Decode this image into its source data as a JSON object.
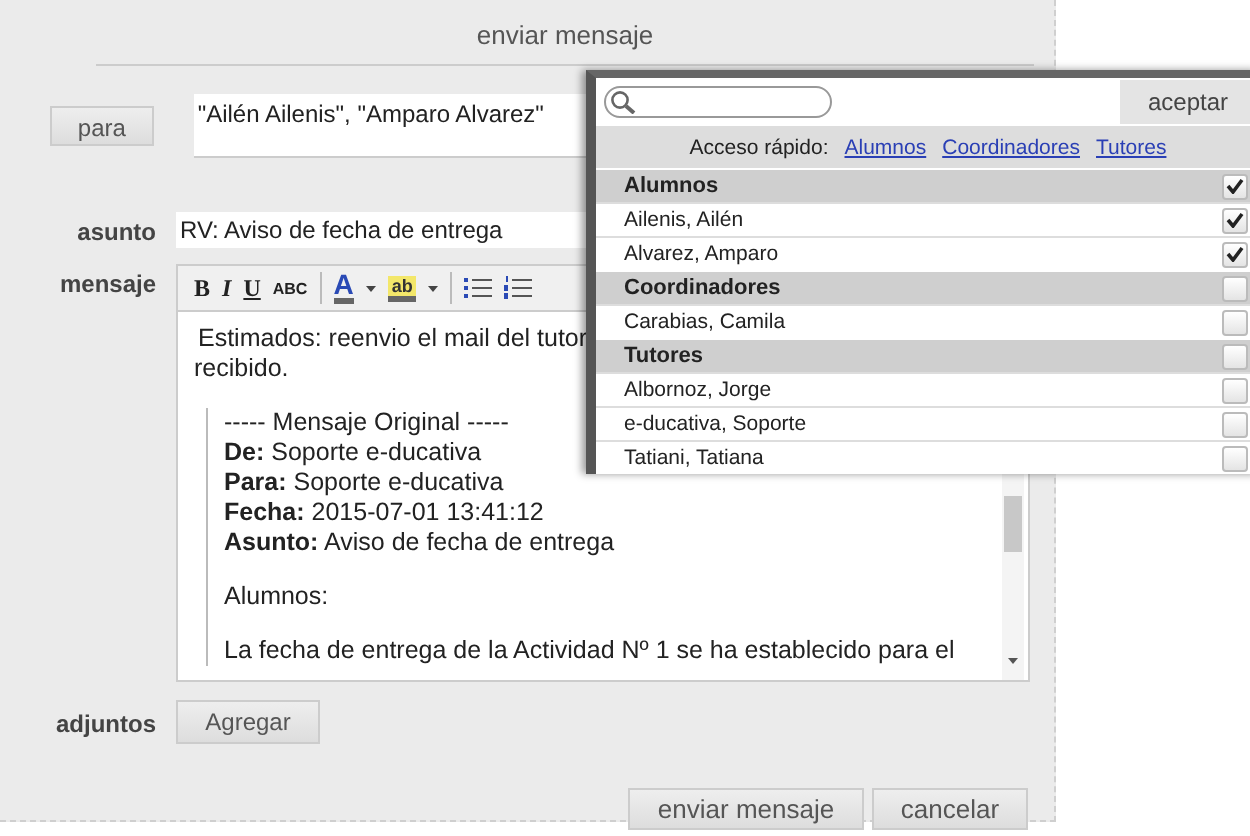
{
  "title": "enviar mensaje",
  "to": {
    "button": "para",
    "value": "\"Ailén Ailenis\", \"Amparo Alvarez\""
  },
  "subject": {
    "label": "asunto",
    "value": "RV: Aviso de fecha de entrega"
  },
  "message": {
    "label": "mensaje",
    "toolbar": [
      {
        "kind": "bold",
        "glyph": "B"
      },
      {
        "kind": "italic",
        "glyph": "I"
      },
      {
        "kind": "underline",
        "glyph": "U"
      },
      {
        "kind": "strike",
        "glyph": "ABC"
      },
      {
        "kind": "separator"
      },
      {
        "kind": "font_color",
        "glyph": "A"
      },
      {
        "kind": "highlight",
        "glyph": "ab"
      },
      {
        "kind": "separator"
      },
      {
        "kind": "bullets"
      },
      {
        "kind": "numbers"
      }
    ],
    "intro": [
      "Estimados: reenvio el mail del tutor",
      "recibido."
    ],
    "quote_header": "----- Mensaje Original -----",
    "quote_fields": [
      {
        "label": "De:",
        "value": "Soporte e-ducativa"
      },
      {
        "label": "Para:",
        "value": "Soporte e-ducativa"
      },
      {
        "label": "Fecha:",
        "value": "2015-07-01 13:41:12"
      },
      {
        "label": "Asunto:",
        "value": "Aviso de fecha de entrega"
      }
    ],
    "body": [
      "Alumnos:",
      "La fecha de entrega de la Actividad Nº 1 se ha establecido para el"
    ]
  },
  "attachments": {
    "label": "adjuntos",
    "button": "Agregar"
  },
  "actions": [
    "enviar mensaje",
    "cancelar"
  ],
  "picker": {
    "accept": "aceptar",
    "quick_label": "Acceso rápido:",
    "quick_links": [
      "Alumnos",
      "Coordinadores",
      "Tutores"
    ],
    "groups": [
      {
        "name": "Alumnos",
        "checked": true,
        "members": [
          {
            "name": "Ailenis, Ailén",
            "checked": true
          },
          {
            "name": "Alvarez, Amparo",
            "checked": true
          }
        ]
      },
      {
        "name": "Coordinadores",
        "checked": false,
        "members": [
          {
            "name": "Carabias, Camila",
            "checked": false
          }
        ]
      },
      {
        "name": "Tutores",
        "checked": false,
        "members": [
          {
            "name": "Albornoz, Jorge",
            "checked": false
          },
          {
            "name": "e-ducativa, Soporte",
            "checked": false
          },
          {
            "name": "Tatiani, Tatiana",
            "checked": false
          }
        ]
      }
    ]
  }
}
